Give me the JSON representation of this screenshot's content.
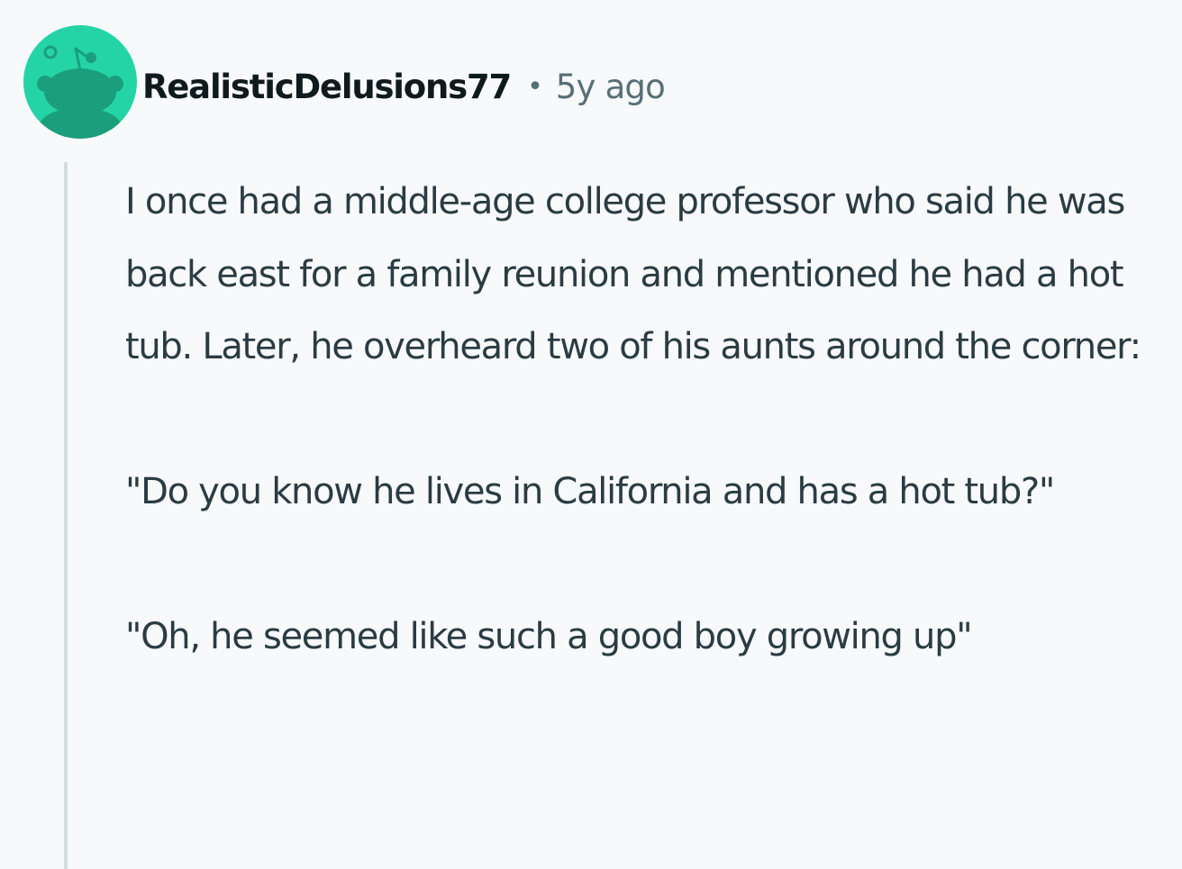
{
  "comment": {
    "author": "RealisticDelusions77",
    "separator": "•",
    "timestamp": "5y ago",
    "avatar_icon": "snoo-avatar-icon",
    "paragraphs": [
      "I once had a middle-age college professor who said he was back east for a family reunion and mentioned he had a hot tub. Later, he overheard two of his aunts around the corner:",
      "\"Do you know he lives in California and has a hot tub?\"",
      "\"Oh, he seemed like such a good boy growing up\""
    ]
  },
  "colors": {
    "background": "#f8f9fb",
    "avatar_bg": "#24d4a7",
    "avatar_figure": "#1b9e7c",
    "username": "#0f1a1c",
    "meta": "#576f76",
    "body_text": "#2a3c42",
    "thread_line": "#d6dde1"
  }
}
